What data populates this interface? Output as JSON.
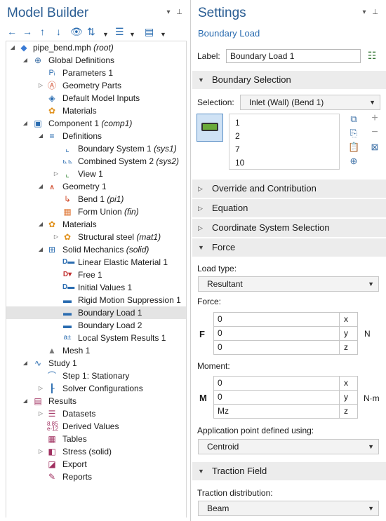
{
  "model_builder": {
    "title": "Model Builder",
    "tree": [
      {
        "label": "pipe_bend.mph",
        "tag": "(root)",
        "icon": "model-file-icon"
      },
      {
        "label": "Global Definitions",
        "tag": "",
        "icon": "globe-icon"
      },
      {
        "label": "Parameters 1",
        "tag": "",
        "icon": "parameters-icon"
      },
      {
        "label": "Geometry Parts",
        "tag": "",
        "icon": "geometry-parts-icon"
      },
      {
        "label": "Default Model Inputs",
        "tag": "",
        "icon": "model-inputs-icon"
      },
      {
        "label": "Materials",
        "tag": "",
        "icon": "materials-icon"
      },
      {
        "label": "Component 1",
        "tag": "(comp1)",
        "icon": "component-icon"
      },
      {
        "label": "Definitions",
        "tag": "",
        "icon": "definitions-icon"
      },
      {
        "label": "Boundary System 1",
        "tag": "(sys1)",
        "icon": "coordinate-system-icon"
      },
      {
        "label": "Combined System 2",
        "tag": "(sys2)",
        "icon": "combined-system-icon"
      },
      {
        "label": "View 1",
        "tag": "",
        "icon": "view-icon"
      },
      {
        "label": "Geometry 1",
        "tag": "",
        "icon": "geometry-icon"
      },
      {
        "label": "Bend 1",
        "tag": "(pi1)",
        "icon": "bend-icon"
      },
      {
        "label": "Form Union",
        "tag": "(fin)",
        "icon": "form-union-icon"
      },
      {
        "label": "Materials",
        "tag": "",
        "icon": "materials-icon"
      },
      {
        "label": "Structural steel",
        "tag": "(mat1)",
        "icon": "material-icon"
      },
      {
        "label": "Solid Mechanics",
        "tag": "(solid)",
        "icon": "solid-mechanics-icon"
      },
      {
        "label": "Linear Elastic Material 1",
        "tag": "",
        "icon": "linear-elastic-icon"
      },
      {
        "label": "Free 1",
        "tag": "",
        "icon": "free-icon"
      },
      {
        "label": "Initial Values 1",
        "tag": "",
        "icon": "initial-values-icon"
      },
      {
        "label": "Rigid Motion Suppression 1",
        "tag": "",
        "icon": "rigid-motion-icon"
      },
      {
        "label": "Boundary Load 1",
        "tag": "",
        "icon": "boundary-load-icon"
      },
      {
        "label": "Boundary Load 2",
        "tag": "",
        "icon": "boundary-load-icon"
      },
      {
        "label": "Local System Results 1",
        "tag": "",
        "icon": "local-results-icon"
      },
      {
        "label": "Mesh 1",
        "tag": "",
        "icon": "mesh-icon"
      },
      {
        "label": "Study 1",
        "tag": "",
        "icon": "study-icon"
      },
      {
        "label": "Step 1: Stationary",
        "tag": "",
        "icon": "stationary-step-icon"
      },
      {
        "label": "Solver Configurations",
        "tag": "",
        "icon": "solver-icon"
      },
      {
        "label": "Results",
        "tag": "",
        "icon": "results-icon"
      },
      {
        "label": "Datasets",
        "tag": "",
        "icon": "datasets-icon"
      },
      {
        "label": "Derived Values",
        "tag": "",
        "icon": "derived-values-icon"
      },
      {
        "label": "Tables",
        "tag": "",
        "icon": "tables-icon"
      },
      {
        "label": "Stress (solid)",
        "tag": "",
        "icon": "plot-group-icon"
      },
      {
        "label": "Export",
        "tag": "",
        "icon": "export-icon"
      },
      {
        "label": "Reports",
        "tag": "",
        "icon": "reports-icon"
      }
    ]
  },
  "settings": {
    "title": "Settings",
    "subtitle": "Boundary Load",
    "label_caption": "Label:",
    "label_value": "Boundary Load 1",
    "sections": {
      "boundary_selection": "Boundary Selection",
      "override": "Override and Contribution",
      "equation": "Equation",
      "coord_sys": "Coordinate System Selection",
      "force": "Force",
      "traction": "Traction Field"
    },
    "selection_caption": "Selection:",
    "selection_value": "Inlet (Wall) (Bend 1)",
    "selection_items": [
      "1",
      "2",
      "7",
      "10"
    ],
    "load_type_caption": "Load type:",
    "load_type_value": "Resultant",
    "force_caption": "Force:",
    "force_symbol": "F",
    "force_values": [
      "0",
      "0",
      "0"
    ],
    "force_unit": "N",
    "moment_caption": "Moment:",
    "moment_symbol": "M",
    "moment_values": [
      "0",
      "0",
      "Mz"
    ],
    "moment_unit": "N·m",
    "axes": [
      "x",
      "y",
      "z"
    ],
    "app_point_caption": "Application point defined using:",
    "app_point_value": "Centroid",
    "traction_caption": "Traction distribution:",
    "traction_value": "Beam"
  }
}
